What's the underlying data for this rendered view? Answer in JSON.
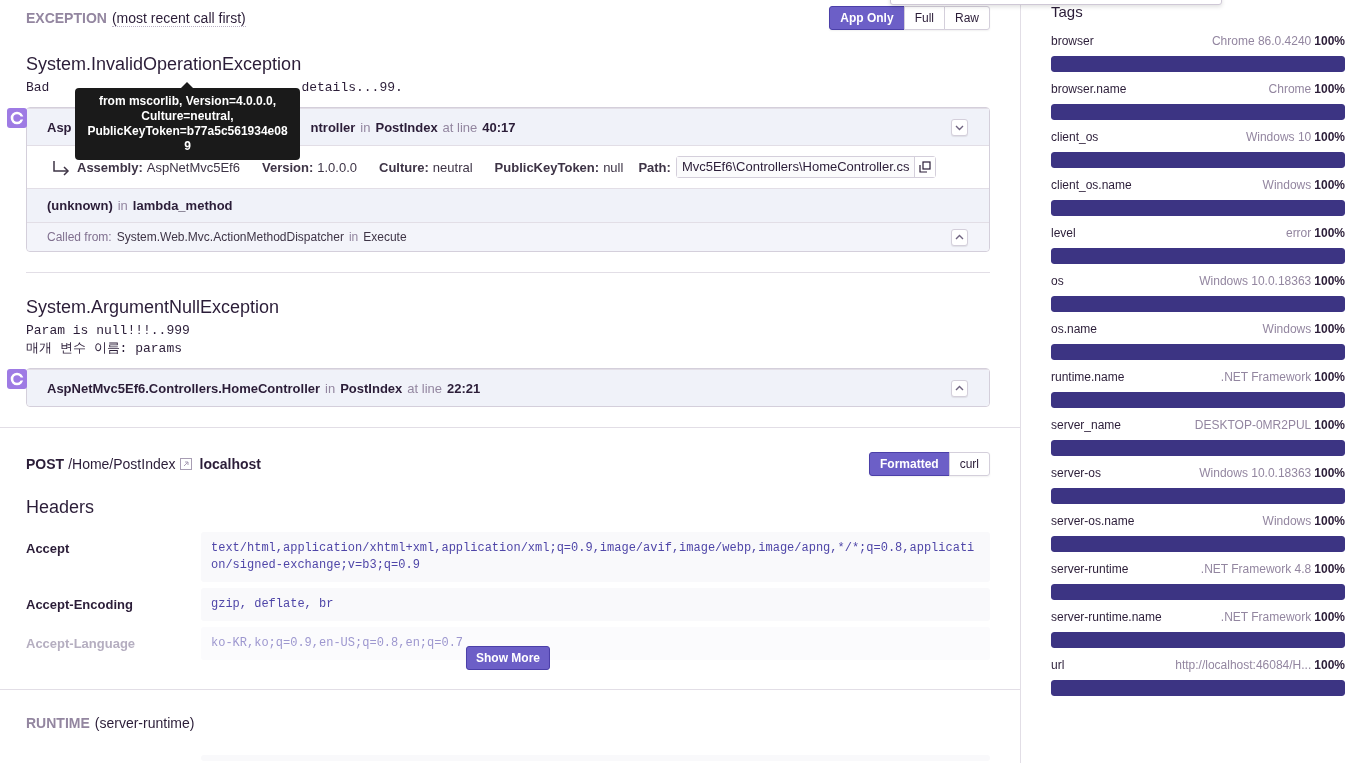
{
  "exception_header": {
    "title": "EXCEPTION",
    "subtitle": "(most recent call first)",
    "view_options": [
      {
        "label": "App Only",
        "selected": true
      },
      {
        "label": "Full",
        "selected": false
      },
      {
        "label": "Raw",
        "selected": false
      }
    ]
  },
  "exceptions": [
    {
      "type": "System.InvalidOperationException",
      "message": [
        [
          "Bad",
          "details...99."
        ]
      ],
      "frames": [
        {
          "kind": "app",
          "module": [
            "Asp",
            "ntroller"
          ],
          "in_text": "in",
          "function": "PostIndex",
          "line_text": "at line",
          "line": "40:17",
          "expanded": true,
          "details": {
            "fields": [
              {
                "label": "Assembly:",
                "value": "AspNetMvc5Ef6"
              },
              {
                "label": "Version:",
                "value": "1.0.0.0"
              },
              {
                "label": "Culture:",
                "value": "neutral"
              },
              {
                "label": "PublicKeyToken:",
                "value": "null"
              }
            ],
            "path_label": "Path:",
            "path": "Mvc5Ef6\\Controllers\\HomeController.cs"
          }
        },
        {
          "kind": "plain",
          "module": "(unknown)",
          "in_text": "in",
          "function": "lambda_method"
        },
        {
          "kind": "called_from",
          "label": "Called from:",
          "module": "System.Web.Mvc.ActionMethodDispatcher",
          "in_text": "in",
          "function": "Execute"
        }
      ]
    },
    {
      "type": "System.ArgumentNullException",
      "message": [
        [
          "Param is null!!!..999"
        ],
        [
          "매개 변수 이름: params"
        ]
      ],
      "frames": [
        {
          "kind": "app",
          "module": "AspNetMvc5Ef6.Controllers.HomeController",
          "in_text": "in",
          "function": "PostIndex",
          "line_text": "at line",
          "line": "22:21",
          "expanded": false
        }
      ]
    }
  ],
  "tooltip": {
    "text": "from mscorlib, Version=4.0.0.0, Culture=neutral, PublicKeyToken=b77a5c561934e089"
  },
  "request": {
    "method": "POST",
    "path": "/Home/PostIndex",
    "host": "localhost",
    "view_options": [
      {
        "label": "Formatted",
        "selected": true
      },
      {
        "label": "curl",
        "selected": false
      }
    ],
    "headers_title": "Headers",
    "headers": [
      {
        "name": "Accept",
        "value": "text/html,application/xhtml+xml,application/xml;q=0.9,image/avif,image/webp,image/apng,*/*;q=0.8,application/signed-exchange;v=b3;q=0.9",
        "faded": false
      },
      {
        "name": "Accept-Encoding",
        "value": "gzip, deflate, br",
        "faded": false
      },
      {
        "name": "Accept-Language",
        "value": "ko-KR,ko;q=0.9,en-US;q=0.8,en;q=0.7",
        "faded": true
      }
    ],
    "show_more": "Show More"
  },
  "runtime": {
    "title": "RUNTIME",
    "subtitle": "(server-runtime)"
  },
  "tags": {
    "title": "Tags",
    "items": [
      {
        "name": "browser",
        "value": "Chrome 86.0.4240",
        "percent": "100%",
        "level": 1
      },
      {
        "name": "browser.name",
        "value": "Chrome",
        "percent": "100%",
        "level": 1
      },
      {
        "name": "client_os",
        "value": "Windows 10",
        "percent": "100%",
        "level": 1
      },
      {
        "name": "client_os.name",
        "value": "Windows",
        "percent": "100%",
        "level": 1
      },
      {
        "name": "level",
        "value": "error",
        "percent": "100%",
        "level": 1
      },
      {
        "name": "os",
        "value": "Windows 10.0.18363",
        "percent": "100%",
        "level": 1
      },
      {
        "name": "os.name",
        "value": "Windows",
        "percent": "100%",
        "level": 1
      },
      {
        "name": "runtime.name",
        "value": ".NET Framework",
        "percent": "100%",
        "level": 1
      },
      {
        "name": "server_name",
        "value": "DESKTOP-0MR2PUL",
        "percent": "100%",
        "level": 1
      },
      {
        "name": "server-os",
        "value": "Windows 10.0.18363",
        "percent": "100%",
        "level": 1
      },
      {
        "name": "server-os.name",
        "value": "Windows",
        "percent": "100%",
        "level": 1
      },
      {
        "name": "server-runtime",
        "value": ".NET Framework 4.8",
        "percent": "100%",
        "level": 1
      },
      {
        "name": "server-runtime.name",
        "value": ".NET Framework",
        "percent": "100%",
        "level": 1
      },
      {
        "name": "url",
        "value": "http://localhost:46084/H...",
        "percent": "100%",
        "level": 1
      }
    ]
  }
}
